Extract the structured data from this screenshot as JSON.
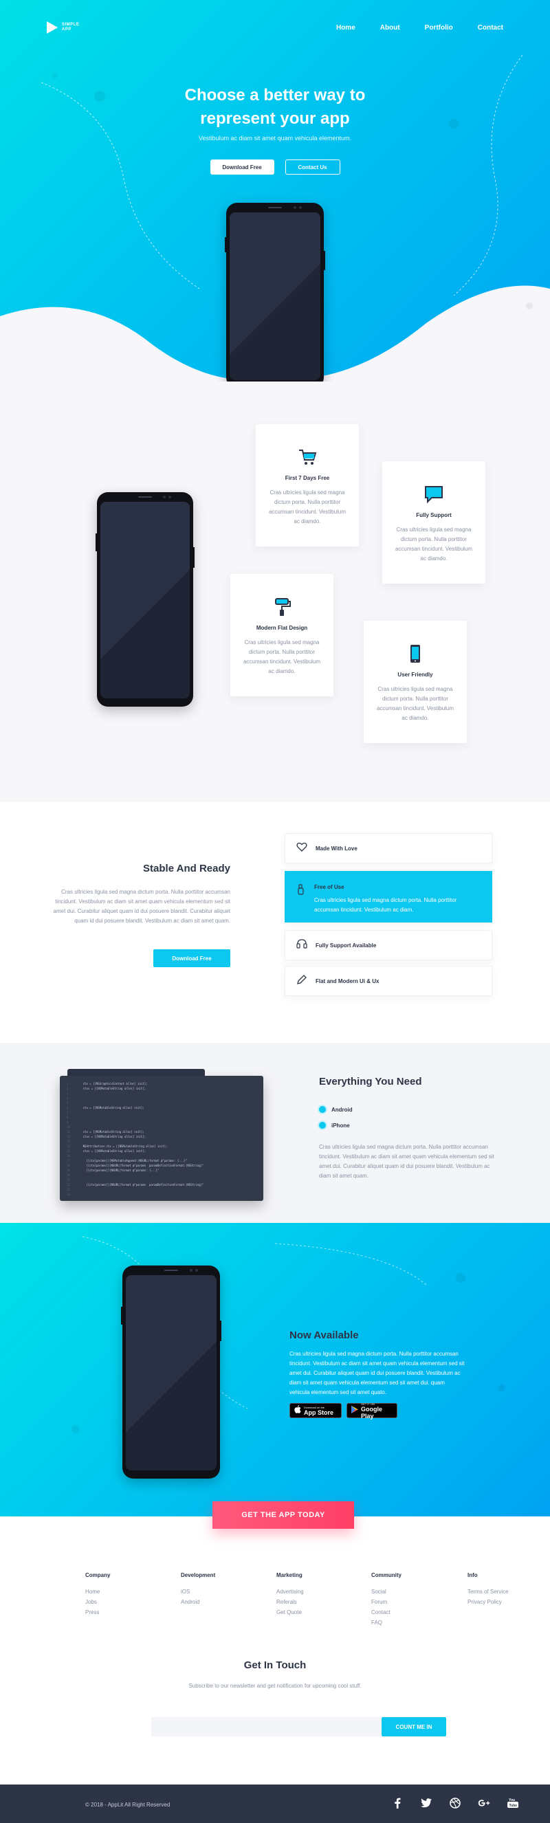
{
  "nav": {
    "logo_line1": "SIMPLE",
    "logo_line2": "APP",
    "links": [
      "Home",
      "About",
      "Portfolio",
      "Contact"
    ]
  },
  "hero": {
    "title_line1": "Choose a better way to",
    "title_line2": "represent your app",
    "subtitle": "Vestibulum ac diam sit amet quam vehicula elementum.",
    "primary_button": "Download Free",
    "secondary_button": "Contact Us"
  },
  "features": [
    {
      "icon": "cart-icon",
      "title": "First 7 Days Free",
      "text": "Cras ultricies ligula sed magna dictum porta. Nulla porttitor accumsan tincidunt. Vestibulum ac diamdo."
    },
    {
      "icon": "chat-bubble-icon",
      "title": "Fully Support",
      "text": "Cras ultricies ligula sed magna dictum porta. Nulla porttitor accumsan tincidunt. Vestibulum ac diamdo."
    },
    {
      "icon": "paint-roller-icon",
      "title": "Modern Flat Design",
      "text": "Cras ultricies ligula sed magna dictum porta. Nulla porttitor accumsan tincidunt. Vestibulum ac diamdo."
    },
    {
      "icon": "smartphone-icon",
      "title": "User Friendly",
      "text": "Cras ultricies ligula sed magna dictum porta. Nulla porttitor accumsan tincidunt. Vestibulum ac diamdo."
    }
  ],
  "stable": {
    "title": "Stable And Ready",
    "text": "Cras ultricies ligula sed magna dictum porta. Nulla porttitor accumsan tincidunt. Vestibulum ac diam sit amet quam vehicula elementum sed sit amet dui. Curabitur aliquet quam id dui posuere blandit. Curabitur aliquet quam id dui posuere blandit. Vestibulum ac diam sit amet quam.",
    "button": "Download Free",
    "items": [
      {
        "icon": "heart-icon",
        "label": "Made With Love"
      },
      {
        "icon": "thumb-icon",
        "label": "Free of Use",
        "text": "Cras ultricies ligula sed magna dictum porta. Nulla porttitor accumsan tincidunt. Vestibulum ac diam."
      },
      {
        "icon": "support-icon",
        "label": "Fully Support Available"
      },
      {
        "icon": "pencil-icon",
        "label": "Flat and Modern Ui & Ux"
      }
    ]
  },
  "everything": {
    "title": "Everything You Need",
    "options": [
      "Android",
      "iPhone"
    ],
    "text": "Cras ultricies ligula sed magna dictum porta. Nulla porttitor accumsan tincidunt. Vestibulum ac diam sit amet quam vehicula elementum sed sit amet dui. Curabitur aliquet quam id dui posuere blandit. Vestibulum ac diam sit amet quam.",
    "code_lines": [
      "    ctx = [[NSGraphicsContext alloc] init];",
      "    ctxs = [[NSMutableString alloc] init];",
      "",
      "",
      "",
      "    ctx = [[NSMutableString alloc] init];",
      "",
      "",
      "",
      "",
      "    ctx = [[NSMutableString alloc] init];",
      "    ctxs = [[NSMutableString alloc] init];",
      "",
      "    NSAttribution ctx = [[NSMutableString alloc] init];",
      "    ctxs = [[NSMutableString alloc] init];",
      "",
      "      [[ctx[params]][NSMutableAppend:(NSURL)format @\"params: {...}\"",
      "      [[ctx[params]][NSURL]format @\"params  paramDefinitionFormat:(NSString)\"",
      "      [[ctx[params]][NSURL]format @\"params: {...}\"",
      "",
      "",
      "      [[ctx[params]][NSURL]format @\"params  paramDefinitionFormat:(NSString)\"",
      "",
      ""
    ]
  },
  "available": {
    "title": "Now Available",
    "text": "Cras ultricies ligula sed magna dictum porta. Nulla porttitor accumsan tincidunt. Vestibulum ac diam sit amet quam vehicula elementum sed sit amet dui. Curabitur aliquet quam id dui posuere blandit. Vestibulum ac diam sit amet quam vehicula elementum sed sit amet dui. quam vehicula elementum sed sit amet quato.",
    "appstore_small": "Download on the",
    "appstore_big": "App Store",
    "googleplay_small": "GET IT ON",
    "googleplay_big": "Google Play",
    "cta": "GET THE APP TODAY"
  },
  "footer_columns": [
    {
      "title": "Company",
      "links": [
        "Home",
        "Jobs",
        "Press"
      ]
    },
    {
      "title": "Development",
      "links": [
        "iOS",
        "Android"
      ]
    },
    {
      "title": "Marketing",
      "links": [
        "Advertising",
        "Referals",
        "Get Quote"
      ]
    },
    {
      "title": "Community",
      "links": [
        "Social",
        "Forum",
        "Contact",
        "FAQ"
      ]
    },
    {
      "title": "Info",
      "links": [
        "Terms of Service",
        "Privacy Policy"
      ]
    }
  ],
  "touch": {
    "title": "Get In Touch",
    "subtitle": "Subscribe to our newsletter and get notification for upcoming cool stuff.",
    "email_placeholder": "",
    "button": "COUNT ME IN"
  },
  "bottom": {
    "copyright": "© 2018 - AppLit All Right Reserved",
    "social": [
      "facebook-icon",
      "twitter-icon",
      "dribbble-icon",
      "google-plus-icon",
      "youtube-icon"
    ]
  },
  "colors": {
    "accent": "#0cc7ef",
    "cta": "#ff4f74",
    "dark": "#2c3445"
  }
}
